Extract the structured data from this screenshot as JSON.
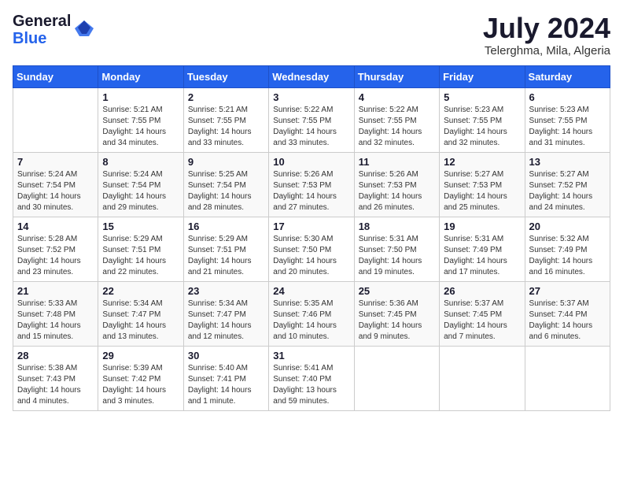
{
  "logo": {
    "general": "General",
    "blue": "Blue"
  },
  "title": {
    "month_year": "July 2024",
    "location": "Telerghma, Mila, Algeria"
  },
  "weekdays": [
    "Sunday",
    "Monday",
    "Tuesday",
    "Wednesday",
    "Thursday",
    "Friday",
    "Saturday"
  ],
  "weeks": [
    [
      {
        "num": "",
        "info": ""
      },
      {
        "num": "1",
        "info": "Sunrise: 5:21 AM\nSunset: 7:55 PM\nDaylight: 14 hours\nand 34 minutes."
      },
      {
        "num": "2",
        "info": "Sunrise: 5:21 AM\nSunset: 7:55 PM\nDaylight: 14 hours\nand 33 minutes."
      },
      {
        "num": "3",
        "info": "Sunrise: 5:22 AM\nSunset: 7:55 PM\nDaylight: 14 hours\nand 33 minutes."
      },
      {
        "num": "4",
        "info": "Sunrise: 5:22 AM\nSunset: 7:55 PM\nDaylight: 14 hours\nand 32 minutes."
      },
      {
        "num": "5",
        "info": "Sunrise: 5:23 AM\nSunset: 7:55 PM\nDaylight: 14 hours\nand 32 minutes."
      },
      {
        "num": "6",
        "info": "Sunrise: 5:23 AM\nSunset: 7:55 PM\nDaylight: 14 hours\nand 31 minutes."
      }
    ],
    [
      {
        "num": "7",
        "info": "Sunrise: 5:24 AM\nSunset: 7:54 PM\nDaylight: 14 hours\nand 30 minutes."
      },
      {
        "num": "8",
        "info": "Sunrise: 5:24 AM\nSunset: 7:54 PM\nDaylight: 14 hours\nand 29 minutes."
      },
      {
        "num": "9",
        "info": "Sunrise: 5:25 AM\nSunset: 7:54 PM\nDaylight: 14 hours\nand 28 minutes."
      },
      {
        "num": "10",
        "info": "Sunrise: 5:26 AM\nSunset: 7:53 PM\nDaylight: 14 hours\nand 27 minutes."
      },
      {
        "num": "11",
        "info": "Sunrise: 5:26 AM\nSunset: 7:53 PM\nDaylight: 14 hours\nand 26 minutes."
      },
      {
        "num": "12",
        "info": "Sunrise: 5:27 AM\nSunset: 7:53 PM\nDaylight: 14 hours\nand 25 minutes."
      },
      {
        "num": "13",
        "info": "Sunrise: 5:27 AM\nSunset: 7:52 PM\nDaylight: 14 hours\nand 24 minutes."
      }
    ],
    [
      {
        "num": "14",
        "info": "Sunrise: 5:28 AM\nSunset: 7:52 PM\nDaylight: 14 hours\nand 23 minutes."
      },
      {
        "num": "15",
        "info": "Sunrise: 5:29 AM\nSunset: 7:51 PM\nDaylight: 14 hours\nand 22 minutes."
      },
      {
        "num": "16",
        "info": "Sunrise: 5:29 AM\nSunset: 7:51 PM\nDaylight: 14 hours\nand 21 minutes."
      },
      {
        "num": "17",
        "info": "Sunrise: 5:30 AM\nSunset: 7:50 PM\nDaylight: 14 hours\nand 20 minutes."
      },
      {
        "num": "18",
        "info": "Sunrise: 5:31 AM\nSunset: 7:50 PM\nDaylight: 14 hours\nand 19 minutes."
      },
      {
        "num": "19",
        "info": "Sunrise: 5:31 AM\nSunset: 7:49 PM\nDaylight: 14 hours\nand 17 minutes."
      },
      {
        "num": "20",
        "info": "Sunrise: 5:32 AM\nSunset: 7:49 PM\nDaylight: 14 hours\nand 16 minutes."
      }
    ],
    [
      {
        "num": "21",
        "info": "Sunrise: 5:33 AM\nSunset: 7:48 PM\nDaylight: 14 hours\nand 15 minutes."
      },
      {
        "num": "22",
        "info": "Sunrise: 5:34 AM\nSunset: 7:47 PM\nDaylight: 14 hours\nand 13 minutes."
      },
      {
        "num": "23",
        "info": "Sunrise: 5:34 AM\nSunset: 7:47 PM\nDaylight: 14 hours\nand 12 minutes."
      },
      {
        "num": "24",
        "info": "Sunrise: 5:35 AM\nSunset: 7:46 PM\nDaylight: 14 hours\nand 10 minutes."
      },
      {
        "num": "25",
        "info": "Sunrise: 5:36 AM\nSunset: 7:45 PM\nDaylight: 14 hours\nand 9 minutes."
      },
      {
        "num": "26",
        "info": "Sunrise: 5:37 AM\nSunset: 7:45 PM\nDaylight: 14 hours\nand 7 minutes."
      },
      {
        "num": "27",
        "info": "Sunrise: 5:37 AM\nSunset: 7:44 PM\nDaylight: 14 hours\nand 6 minutes."
      }
    ],
    [
      {
        "num": "28",
        "info": "Sunrise: 5:38 AM\nSunset: 7:43 PM\nDaylight: 14 hours\nand 4 minutes."
      },
      {
        "num": "29",
        "info": "Sunrise: 5:39 AM\nSunset: 7:42 PM\nDaylight: 14 hours\nand 3 minutes."
      },
      {
        "num": "30",
        "info": "Sunrise: 5:40 AM\nSunset: 7:41 PM\nDaylight: 14 hours\nand 1 minute."
      },
      {
        "num": "31",
        "info": "Sunrise: 5:41 AM\nSunset: 7:40 PM\nDaylight: 13 hours\nand 59 minutes."
      },
      {
        "num": "",
        "info": ""
      },
      {
        "num": "",
        "info": ""
      },
      {
        "num": "",
        "info": ""
      }
    ]
  ]
}
